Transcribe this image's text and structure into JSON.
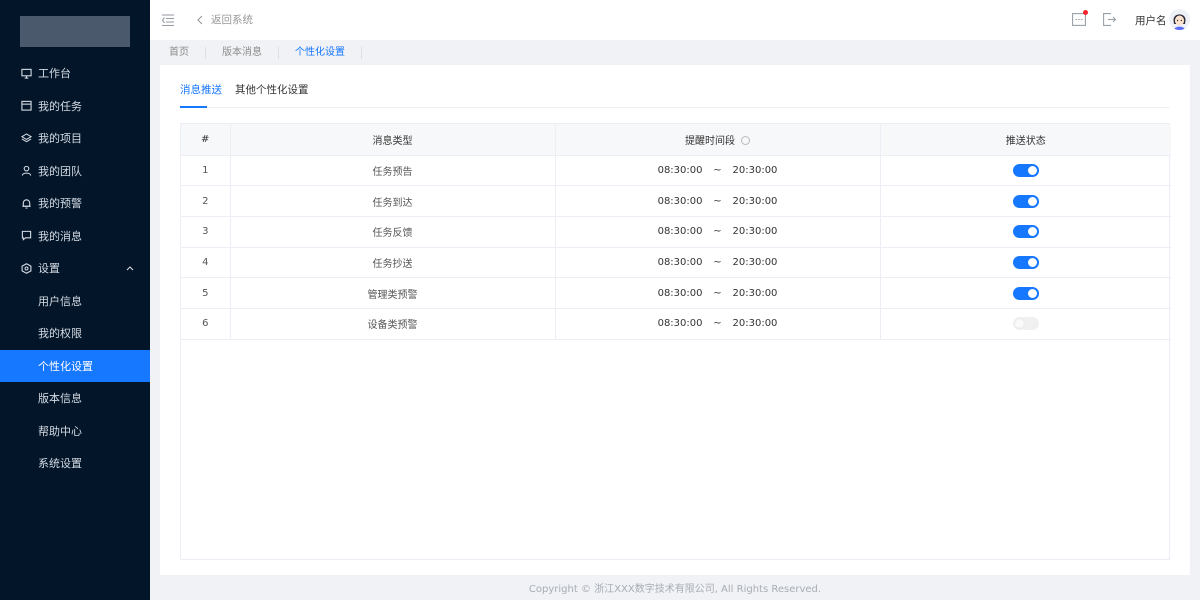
{
  "sidebar": {
    "items": [
      {
        "label": "工作台",
        "icon": "monitor-icon"
      },
      {
        "label": "我的任务",
        "icon": "calendar-icon"
      },
      {
        "label": "我的项目",
        "icon": "layers-icon"
      },
      {
        "label": "我的团队",
        "icon": "user-icon"
      },
      {
        "label": "我的预警",
        "icon": "bell-icon"
      },
      {
        "label": "我的消息",
        "icon": "message-icon"
      },
      {
        "label": "设置",
        "icon": "settings-hex-icon",
        "expanded": true
      }
    ],
    "sub_items": [
      {
        "label": "用户信息"
      },
      {
        "label": "我的权限"
      },
      {
        "label": "个性化设置",
        "active": true
      },
      {
        "label": "版本信息"
      },
      {
        "label": "帮助中心"
      },
      {
        "label": "系统设置"
      }
    ]
  },
  "header": {
    "back_label": "返回系统",
    "username": "用户名",
    "has_notification": true
  },
  "tabbar": {
    "tabs": [
      "首页",
      "版本消息",
      "个性化设置"
    ],
    "active_index": 2
  },
  "inner_tabs": {
    "tabs": [
      "消息推送",
      "其他个性化设置"
    ],
    "active_index": 0
  },
  "table": {
    "headers": {
      "index": "#",
      "type": "消息类型",
      "time": "提醒时间段",
      "status": "推送状态"
    },
    "rows": [
      {
        "index": "1",
        "type": "任务预告",
        "start": "08:30:00",
        "sep": "~",
        "end": "20:30:00",
        "enabled": true
      },
      {
        "index": "2",
        "type": "任务到达",
        "start": "08:30:00",
        "sep": "~",
        "end": "20:30:00",
        "enabled": true
      },
      {
        "index": "3",
        "type": "任务反馈",
        "start": "08:30:00",
        "sep": "~",
        "end": "20:30:00",
        "enabled": true
      },
      {
        "index": "4",
        "type": "任务抄送",
        "start": "08:30:00",
        "sep": "~",
        "end": "20:30:00",
        "enabled": true
      },
      {
        "index": "5",
        "type": "管理类预警",
        "start": "08:30:00",
        "sep": "~",
        "end": "20:30:00",
        "enabled": true
      },
      {
        "index": "6",
        "type": "设备类预警",
        "start": "08:30:00",
        "sep": "~",
        "end": "20:30:00",
        "enabled": false
      }
    ]
  },
  "footer": {
    "copyright": "Copyright © 浙江XXX数字技术有限公司, All Rights Reserved."
  },
  "colors": {
    "sidebar_bg": "#021529",
    "accent": "#1677ff",
    "page_bg": "#f0f2f5"
  }
}
